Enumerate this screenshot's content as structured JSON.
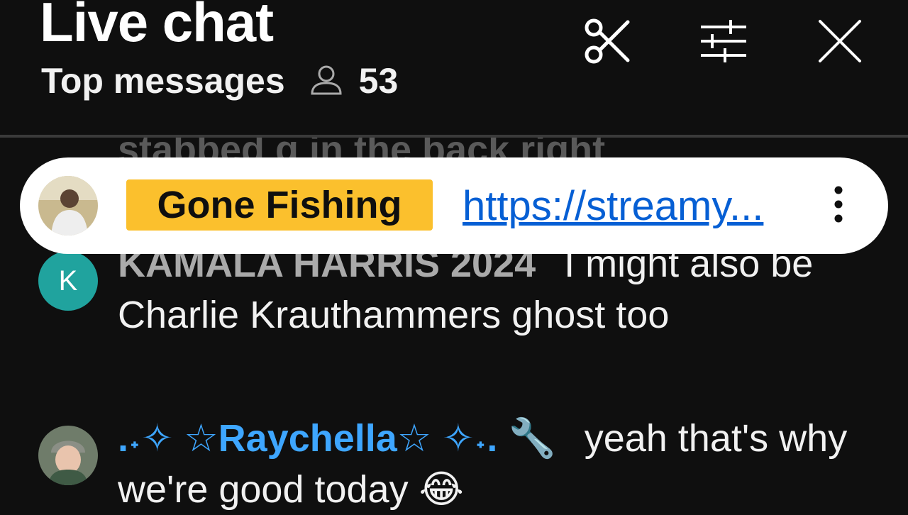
{
  "header": {
    "title": "Live chat",
    "mode_label": "Top messages",
    "viewer_count": "53",
    "icons": [
      "clip-icon",
      "filter-icon",
      "close-icon"
    ]
  },
  "pinned": {
    "author": "Gone Fishing",
    "link": "https://streamy...",
    "more_icon": "more-vert-icon"
  },
  "partial_message": "stabbed g in the back right",
  "messages": [
    {
      "avatar_letter": "K",
      "author": "KAMALA HARRIS 2024",
      "text": "I might also be Charlie Krauthammers ghost too"
    },
    {
      "author": ".˖✧ ☆Raychella☆ ✧˖. 🔧",
      "text": "yeah that's why we're good today 😂"
    }
  ],
  "colors": {
    "background": "#0f0f0f",
    "pinned_author_bg": "#fbc02d",
    "link": "#065fd4",
    "author_gray": "#aaaaaa",
    "author_blue": "#3ea6ff",
    "avatar_k": "#20a39e"
  }
}
